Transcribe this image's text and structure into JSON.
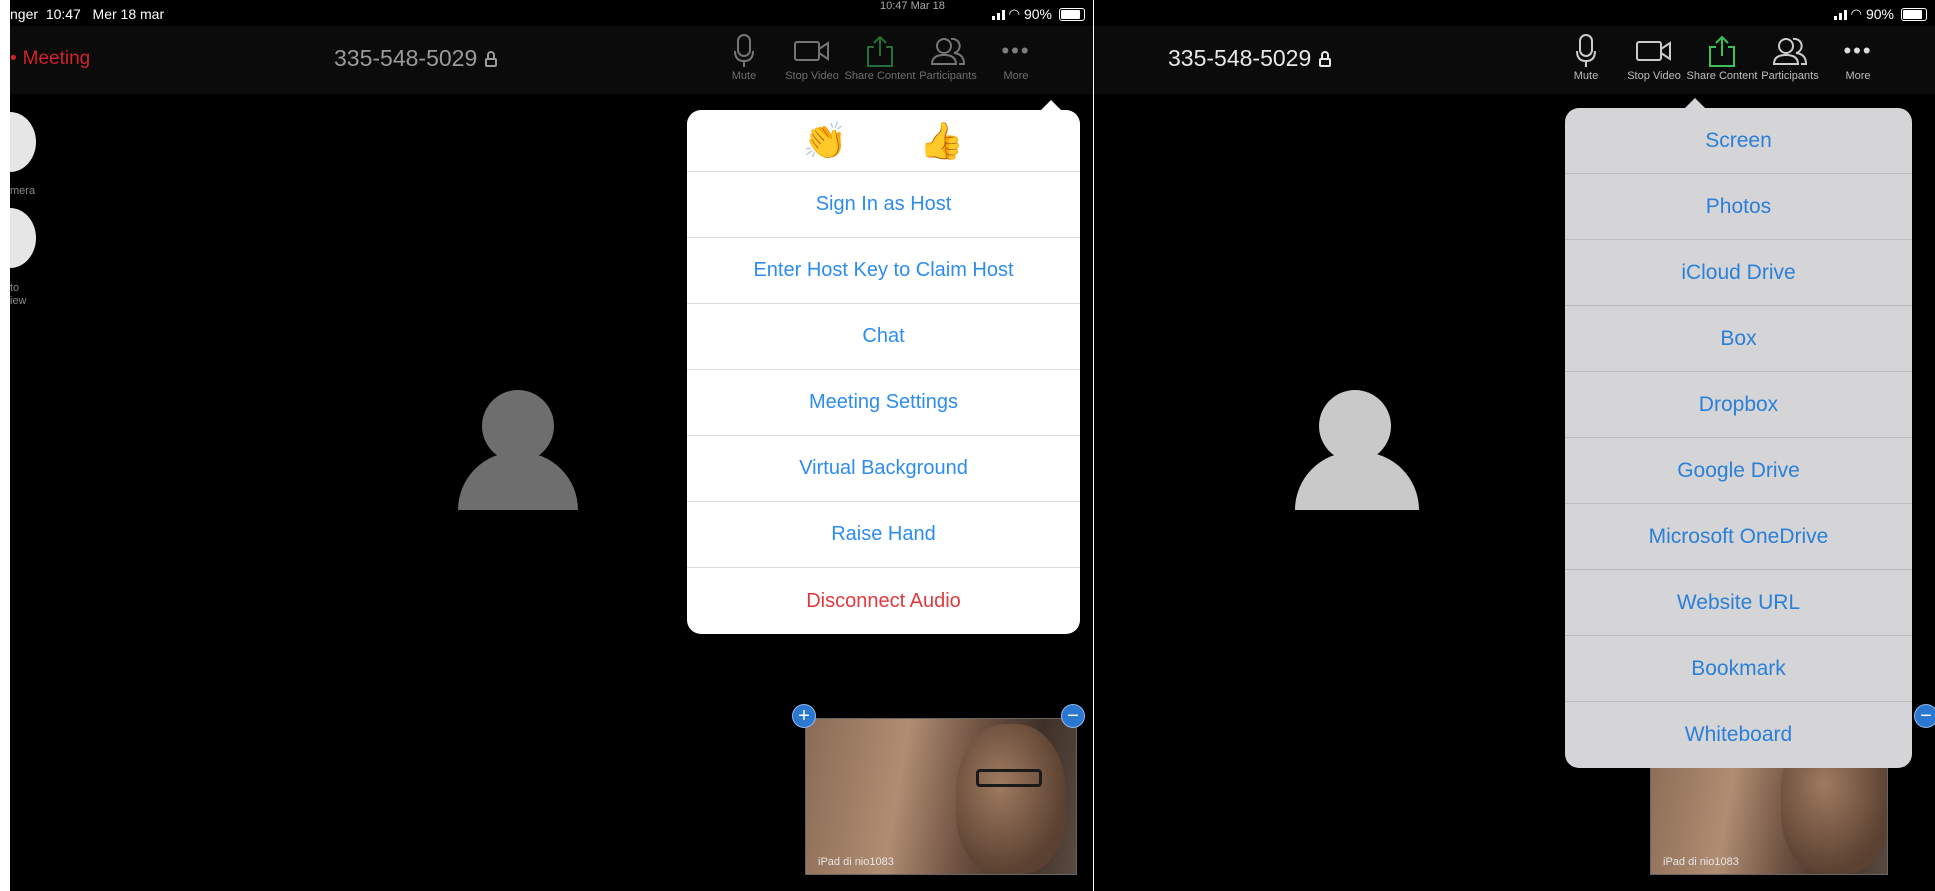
{
  "left": {
    "status": {
      "carrier": "nger",
      "time": "10:47",
      "date": "Mer 18 mar",
      "battery": "90%",
      "center_time": "10:47 Mar 18"
    },
    "leave_label": "Meeting",
    "meeting_id": "335-548-5029",
    "toolbar": {
      "mute": "Mute",
      "stop_video": "Stop Video",
      "share": "Share Content",
      "participants": "Participants",
      "more": "More"
    },
    "side": {
      "camera_label": "mera",
      "preview_label_1": "to",
      "preview_label_2": "iew"
    },
    "more_menu": {
      "reactions": [
        "👏",
        "👍"
      ],
      "items": [
        "Sign In as Host",
        "Enter Host Key to Claim Host",
        "Chat",
        "Meeting Settings",
        "Virtual Background",
        "Raise Hand"
      ],
      "danger_item": "Disconnect Audio"
    },
    "self_view_name": "iPad di nio1083"
  },
  "right": {
    "status": {
      "battery": "90%"
    },
    "meeting_id": "335-548-5029",
    "toolbar": {
      "mute": "Mute",
      "stop_video": "Stop Video",
      "share": "Share Content",
      "participants": "Participants",
      "more": "More"
    },
    "share_menu": [
      "Screen",
      "Photos",
      "iCloud Drive",
      "Box",
      "Dropbox",
      "Google Drive",
      "Microsoft OneDrive",
      "Website URL",
      "Bookmark",
      "Whiteboard"
    ],
    "self_view_name": "iPad di nio1083"
  },
  "colors": {
    "accent_blue": "#2d8cf0",
    "leave_red": "#d3222a",
    "share_green": "#3fbf5a",
    "danger_red": "#e0393e"
  },
  "icons": {
    "mute": "microphone-icon",
    "video": "video-camera-icon",
    "share": "share-upload-icon",
    "participants": "participants-icon",
    "more": "ellipsis-icon"
  }
}
